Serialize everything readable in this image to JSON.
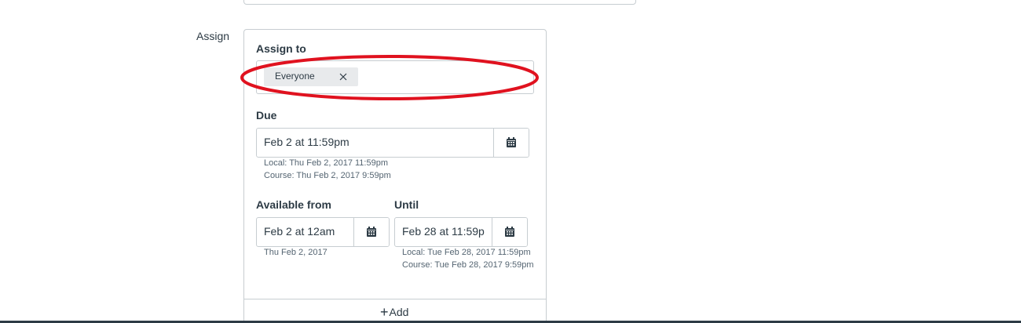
{
  "assign": {
    "section_label": "Assign",
    "assign_to_label": "Assign to",
    "token_label": "Everyone",
    "token_remove_icon": "close-icon",
    "due": {
      "label": "Due",
      "value": "Feb 2 at 11:59pm",
      "local": "Local: Thu Feb 2, 2017 11:59pm",
      "course": "Course: Thu Feb 2, 2017 9:59pm"
    },
    "available_from": {
      "label": "Available from",
      "value": "Feb 2 at 12am",
      "hint": "Thu Feb 2, 2017"
    },
    "until": {
      "label": "Until",
      "value": "Feb 28 at 11:59p",
      "local": "Local: Tue Feb 28, 2017 11:59pm",
      "course": "Course: Tue Feb 28, 2017 9:59pm"
    },
    "add_label": "Add",
    "calendar_icon": "calendar-icon"
  },
  "annotation": {
    "color": "#e0121f"
  }
}
